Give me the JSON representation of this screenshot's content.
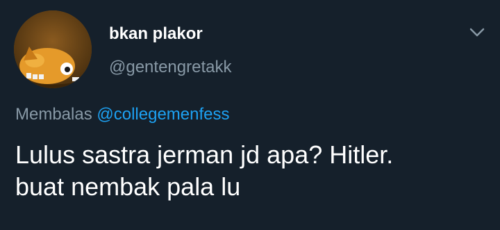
{
  "user": {
    "display_name": "bkan plakor",
    "handle": "@gentengretakk"
  },
  "reply": {
    "prefix": "Membalas",
    "target": "@collegemenfess"
  },
  "tweet": {
    "lines": [
      "Lulus sastra jerman jd apa? Hitler.",
      "buat nembak pala lu"
    ]
  },
  "icons": {
    "menu": "chevron-down-icon",
    "avatar": "cartoon-dog-avatar"
  },
  "colors": {
    "background": "#15202b",
    "primary_text": "#ffffff",
    "secondary_text": "#8899a6",
    "link": "#1da1f2"
  }
}
